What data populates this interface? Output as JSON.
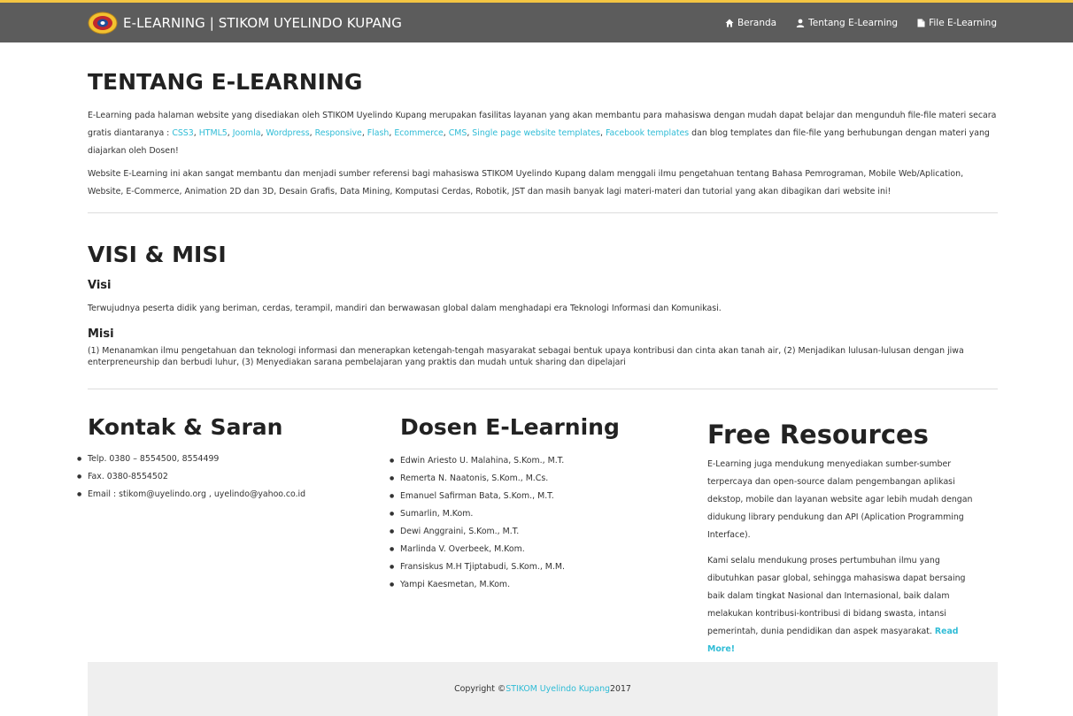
{
  "navbar": {
    "brand": "E-LEARNING | STIKOM UYELINDO KUPANG",
    "items": [
      {
        "label": "Beranda",
        "icon": "home-icon"
      },
      {
        "label": "Tentang E-Learning",
        "icon": "user-icon"
      },
      {
        "label": "File E-Learning",
        "icon": "file-icon"
      }
    ]
  },
  "about": {
    "title": "TENTANG E-LEARNING",
    "p1_start": "E-Learning pada halaman website yang disediakan oleh STIKOM Uyelindo Kupang merupakan fasilitas layanan yang akan membantu para mahasiswa dengan mudah dapat belajar dan mengunduh file-file materi secara gratis diantaranya : ",
    "links": [
      "CSS3",
      "HTML5",
      "Joomla",
      "Wordpress",
      "Responsive",
      "Flash",
      "Ecommerce",
      "CMS",
      "Single page website templates",
      "Facebook templates"
    ],
    "p1_end": " dan blog templates dan file-file yang berhubungan dengan materi yang diajarkan oleh Dosen!",
    "p2": "Website E-Learning ini akan sangat membantu dan menjadi sumber referensi bagi mahasiswa STIKOM Uyelindo Kupang dalam menggali ilmu pengetahuan tentang Bahasa Pemrograman, Mobile Web/Aplication, Website, E-Commerce, Animation 2D dan 3D, Desain Grafis, Data Mining, Komputasi Cerdas, Robotik, JST dan masih banyak lagi materi-materi dan tutorial yang akan dibagikan dari website ini!"
  },
  "visimisi": {
    "title": "VISI & MISI",
    "visi_title": "Visi",
    "visi_text": "Terwujudnya peserta didik yang beriman, cerdas, terampil, mandiri dan berwawasan global dalam menghadapi era Teknologi Informasi dan Komunikasi.",
    "misi_title": "Misi",
    "misi_text": "(1) Menanamkan ilmu pengetahuan dan teknologi informasi dan menerapkan ketengah-tengah masyarakat sebagai bentuk upaya kontribusi dan cinta akan tanah air, (2) Menjadikan lulusan-lulusan dengan jiwa enterpreneurship dan berbudi luhur, (3) Menyediakan sarana pembelajaran yang praktis dan mudah untuk sharing dan dipelajari"
  },
  "contact": {
    "title": "Kontak & Saran",
    "items": [
      "Telp. 0380 – 8554500, 8554499",
      "Fax. 0380-8554502",
      "Email : stikom@uyelindo.org , uyelindo@yahoo.co.id"
    ]
  },
  "dosen": {
    "title": "Dosen E-Learning",
    "items": [
      "Edwin Ariesto U. Malahina, S.Kom., M.T.",
      "Remerta N. Naatonis, S.Kom., M.Cs.",
      "Emanuel Safirman Bata, S.Kom., M.T.",
      "Sumarlin, M.Kom.",
      "Dewi Anggraini, S.Kom., M.T.",
      "Marlinda V. Overbeek, M.Kom.",
      "Fransiskus M.H Tjiptabudi, S.Kom., M.M.",
      "Yampi Kaesmetan, M.Kom."
    ]
  },
  "resources": {
    "title": "Free Resources",
    "p1": "E-Learning juga mendukung menyediakan sumber-sumber terpercaya dan open-source dalam pengembangan aplikasi dekstop, mobile dan layanan website agar lebih mudah dengan didukung library pendukung dan API (Aplication Programming Interface).",
    "p2": "Kami selalu mendukung proses pertumbuhan ilmu yang dibutuhkan pasar global, sehingga mahasiswa dapat bersaing baik dalam tingkat Nasional dan Internasional, baik dalam melakukan kontribusi-kontribusi di bidang swasta, intansi pemerintah, dunia pendidikan dan aspek masyarakat. ",
    "read_more": "Read More!"
  },
  "footer": {
    "prefix": "Copyright © ",
    "link": "STIKOM Uyelindo Kupang",
    "suffix": " 2017"
  },
  "colors": {
    "navbar": "#5c5c5c",
    "link": "#2fbcd6",
    "footer": "#efefef",
    "stripe": "#f4c542"
  }
}
